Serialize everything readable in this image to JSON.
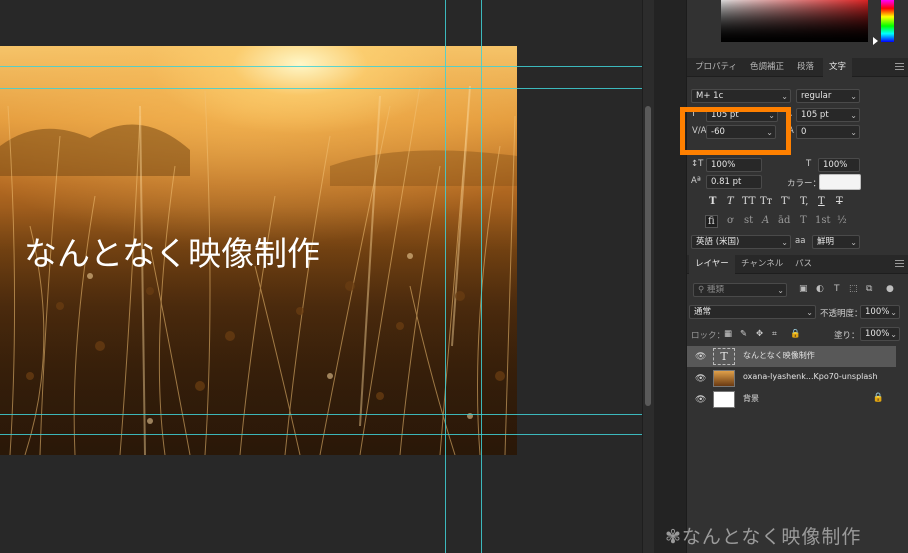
{
  "document": {
    "text_layer_content": "なんとなく映像制作"
  },
  "panel_tabs": [
    "プロパティ",
    "色調補正",
    "段落",
    "文字"
  ],
  "character": {
    "font_family": "M+ 1c",
    "font_style": "regular",
    "font_size": "105 pt",
    "leading": "105 pt",
    "kerning": "-60",
    "tracking": "0",
    "vertical_scale": "100%",
    "horizontal_scale": "100%",
    "baseline_shift": "0.81 pt",
    "color_label": "カラー：",
    "language": "英語 (米国)",
    "antialias": "鮮明",
    "aa_glyph": "aa",
    "style_glyphs": [
      "T",
      "T",
      "TT",
      "Tт",
      "T'",
      "T,",
      "T",
      "T"
    ],
    "opentype_glyphs": [
      "fi",
      "ơ",
      "st",
      "A",
      "ād",
      "T",
      "1st",
      "½"
    ]
  },
  "layers_tabs": [
    "レイヤー",
    "チャンネル",
    "パス"
  ],
  "layers": {
    "search_placeholder": "種類",
    "blend_mode": "通常",
    "opacity_label": "不透明度：",
    "opacity_value": "100%",
    "lock_label": "ロック：",
    "fill_label": "塗り：",
    "fill_value": "100%",
    "items": [
      {
        "name": "なんとなく映像制作",
        "type": "text",
        "selected": true,
        "thumb_glyph": "T"
      },
      {
        "name": "oxana-lyashenk...Kpo70-unsplash",
        "type": "smart-object",
        "selected": false
      },
      {
        "name": "背景",
        "type": "background",
        "selected": false,
        "lock_glyph": "🔒"
      }
    ]
  },
  "icons": {
    "eye": "👁",
    "menu": "panel-menu-icon",
    "search": "⚲",
    "caret": "⌄"
  },
  "watermark": "なんとなく映像制作",
  "colors": {
    "guide": "#3fd1d6",
    "highlight": "#ff8000",
    "panel_bg": "#323232",
    "canvas_bg": "#282828"
  }
}
